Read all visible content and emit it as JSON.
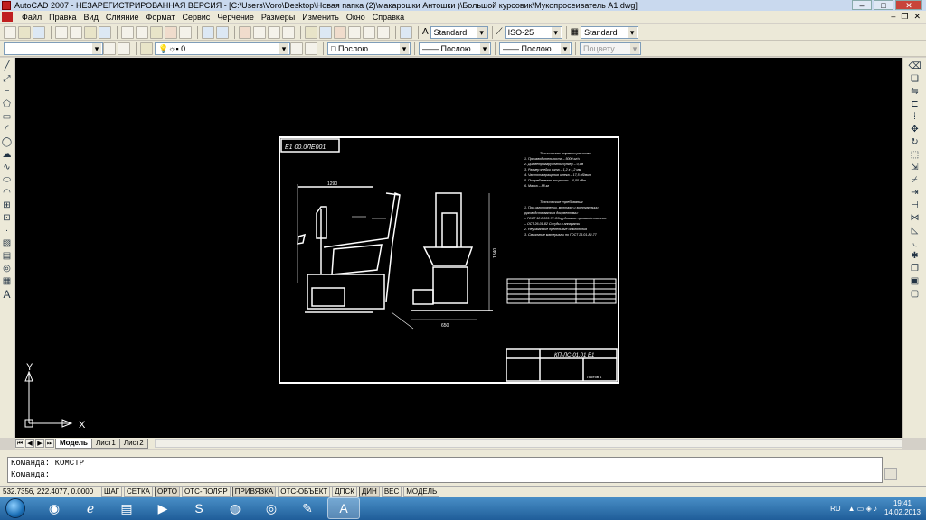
{
  "window": {
    "title": "AutoCAD 2007 - НЕЗАРЕГИСТРИРОВАННАЯ ВЕРСИЯ - [C:\\Users\\Voro\\Desktop\\Новая папка (2)\\макарошки Антошки )\\Большой курсовик\\Мукопросеиватель А1.dwg]"
  },
  "menu": {
    "items": [
      "Файл",
      "Правка",
      "Вид",
      "Слияние",
      "Формат",
      "Сервис",
      "Черчение",
      "Размеры",
      "Изменить",
      "Окно",
      "Справка"
    ]
  },
  "toolbar": {
    "text_style": "Standard",
    "dim_style": "ISO-25",
    "table_style": "Standard",
    "layer": "0",
    "color": "Послою",
    "linetype": "Послою",
    "lineweight": "Послою",
    "plot_style": "Поцвету"
  },
  "tabs": [
    "Модель",
    "Лист1",
    "Лист2"
  ],
  "command": {
    "line1": "Команда: КОМСТР",
    "line2": "Команда:"
  },
  "status": {
    "coords": "532.7356, 222.4077, 0.0000",
    "buttons": [
      "ШАГ",
      "СЕТКА",
      "ОРТО",
      "ОТС-ПОЛЯР",
      "ПРИВЯЗКА",
      "ОТС-ОБЪЕКТ",
      "ДПСК",
      "ДИН",
      "ВЕС",
      "МОДЕЛЬ"
    ]
  },
  "drawing": {
    "stamp": "Е1 00.0ЛЕ001",
    "dim_width": "1290",
    "dim_height": "1840",
    "dim_base": "650",
    "titleblock_code": "КП-ЛС-01.01 Е1",
    "sheet": "Листов 1",
    "ucs_x": "X",
    "ucs_y": "Y",
    "tech_title": "Технические характеристики",
    "tech_lines": [
      "1. Производительность – 5000 кг/ч",
      "2. Диаметр загрузочной бункер – 0,4м",
      "3. Размер ячейки сита – 1,2 х 1,2 мм",
      "4. Частота вращения шнека – 17,5 об/мин",
      "5. Потребляемая мощность – 0,55 кВт",
      "6. Масса – 88 кг"
    ],
    "req_title": "Технические требования",
    "req_lines": [
      "1. При изготовлении, монтаже и эксплуатации",
      "руководствоваться документами:",
      "– ГОСТ 12.2.003-74 Оборудование производственное",
      "– ОСТ 26-01-82 Сосуды и аппараты",
      "2. Неуказанные предельные отклонения",
      "3. Смазочные материалы по ГОСТ 26.01-82-77"
    ]
  },
  "tray": {
    "lang": "RU",
    "time": "19:41",
    "date": "14.02.2013"
  }
}
